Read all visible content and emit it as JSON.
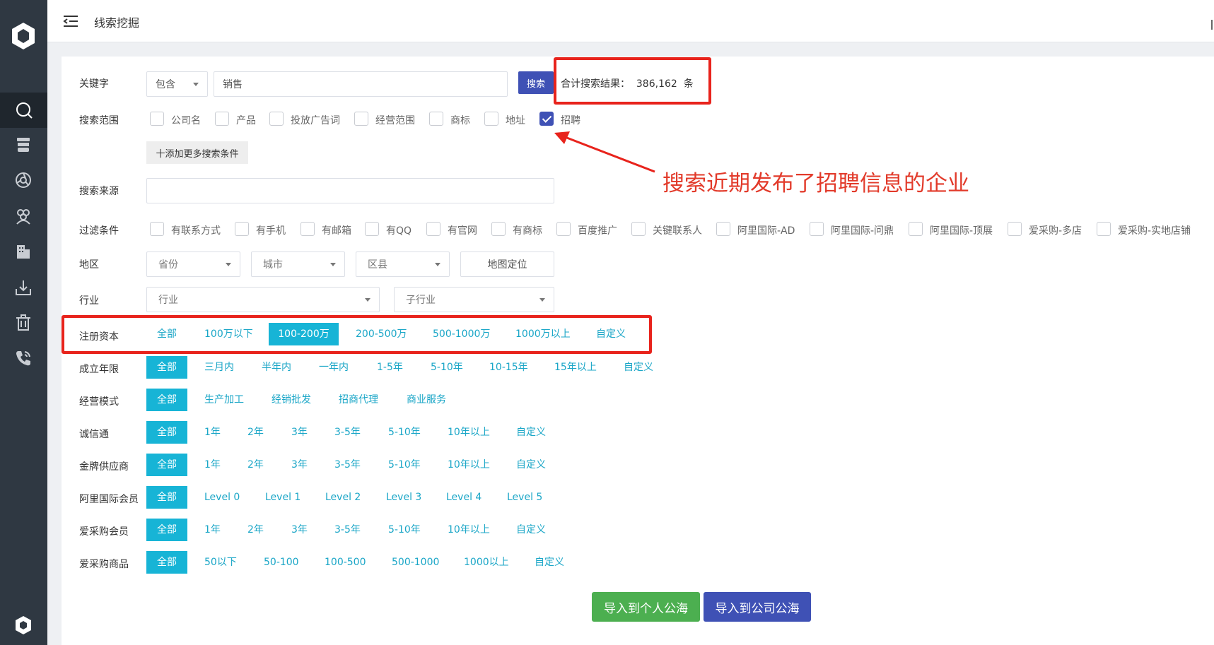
{
  "header": {
    "title": "线索挖掘"
  },
  "sidebar": {
    "icons": [
      "logo-icon",
      "search-icon",
      "database-icon",
      "aperture-icon",
      "users-icon",
      "building-icon",
      "download-icon",
      "trash-icon",
      "phone-icon",
      "logo-bottom-icon"
    ]
  },
  "keyword": {
    "label": "关键字",
    "mode": "包含",
    "value": "销售",
    "search_btn": "搜索",
    "result_text": "合计搜索结果：  386,162  条"
  },
  "scope": {
    "label": "搜索范围",
    "items": [
      {
        "label": "公司名",
        "checked": false
      },
      {
        "label": "产品",
        "checked": false
      },
      {
        "label": "投放广告词",
        "checked": false
      },
      {
        "label": "经营范围",
        "checked": false
      },
      {
        "label": "商标",
        "checked": false
      },
      {
        "label": "地址",
        "checked": false
      },
      {
        "label": "招聘",
        "checked": true
      }
    ],
    "add_btn": "十添加更多搜索条件"
  },
  "source": {
    "label": "搜索来源",
    "value": ""
  },
  "filter": {
    "label": "过滤条件",
    "items": [
      "有联系方式",
      "有手机",
      "有邮箱",
      "有QQ",
      "有官网",
      "有商标",
      "百度推广",
      "关键联系人",
      "阿里国际-AD",
      "阿里国际-问鼎",
      "阿里国际-顶展",
      "爱采购-多店",
      "爱采购-实地店铺"
    ]
  },
  "region": {
    "label": "地区",
    "province": "省份",
    "city": "城市",
    "district": "区县",
    "map_btn": "地图定位"
  },
  "industry": {
    "label": "行业",
    "industry": "行业",
    "sub_industry": "子行业"
  },
  "capital": {
    "label": "注册资本",
    "options": [
      "全部",
      "100万以下",
      "100-200万",
      "200-500万",
      "500-1000万",
      "1000万以上",
      "自定义"
    ],
    "selected": "100-200万"
  },
  "founded": {
    "label": "成立年限",
    "options": [
      "全部",
      "三月内",
      "半年内",
      "一年内",
      "1-5年",
      "5-10年",
      "10-15年",
      "15年以上",
      "自定义"
    ],
    "selected": "全部"
  },
  "mode": {
    "label": "经营模式",
    "options": [
      "全部",
      "生产加工",
      "经销批发",
      "招商代理",
      "商业服务"
    ],
    "selected": "全部"
  },
  "chengxin": {
    "label": "诚信通",
    "options": [
      "全部",
      "1年",
      "2年",
      "3年",
      "3-5年",
      "5-10年",
      "10年以上",
      "自定义"
    ],
    "selected": "全部"
  },
  "gold": {
    "label": "金牌供应商",
    "options": [
      "全部",
      "1年",
      "2年",
      "3年",
      "3-5年",
      "5-10年",
      "10年以上",
      "自定义"
    ],
    "selected": "全部"
  },
  "alibaba": {
    "label": "阿里国际会员",
    "options": [
      "全部",
      "Level 0",
      "Level 1",
      "Level 2",
      "Level 3",
      "Level 4",
      "Level 5"
    ],
    "selected": "全部"
  },
  "aicaigou": {
    "label": "爱采购会员",
    "options": [
      "全部",
      "1年",
      "2年",
      "3年",
      "3-5年",
      "5-10年",
      "10年以上",
      "自定义"
    ],
    "selected": "全部"
  },
  "goods": {
    "label": "爱采购商品",
    "options": [
      "全部",
      "50以下",
      "50-100",
      "100-500",
      "500-1000",
      "1000以上",
      "自定义"
    ],
    "selected": "全部"
  },
  "annotation": {
    "text": "搜索近期发布了招聘信息的企业"
  },
  "actions": {
    "import_personal": "导入到个人公海",
    "import_company": "导入到公司公海"
  },
  "colors": {
    "sidebar": "#2f3842",
    "primary": "#3f51b5",
    "accent": "#17b4d6",
    "green": "#4caf50",
    "highlight": "#e8231c"
  }
}
